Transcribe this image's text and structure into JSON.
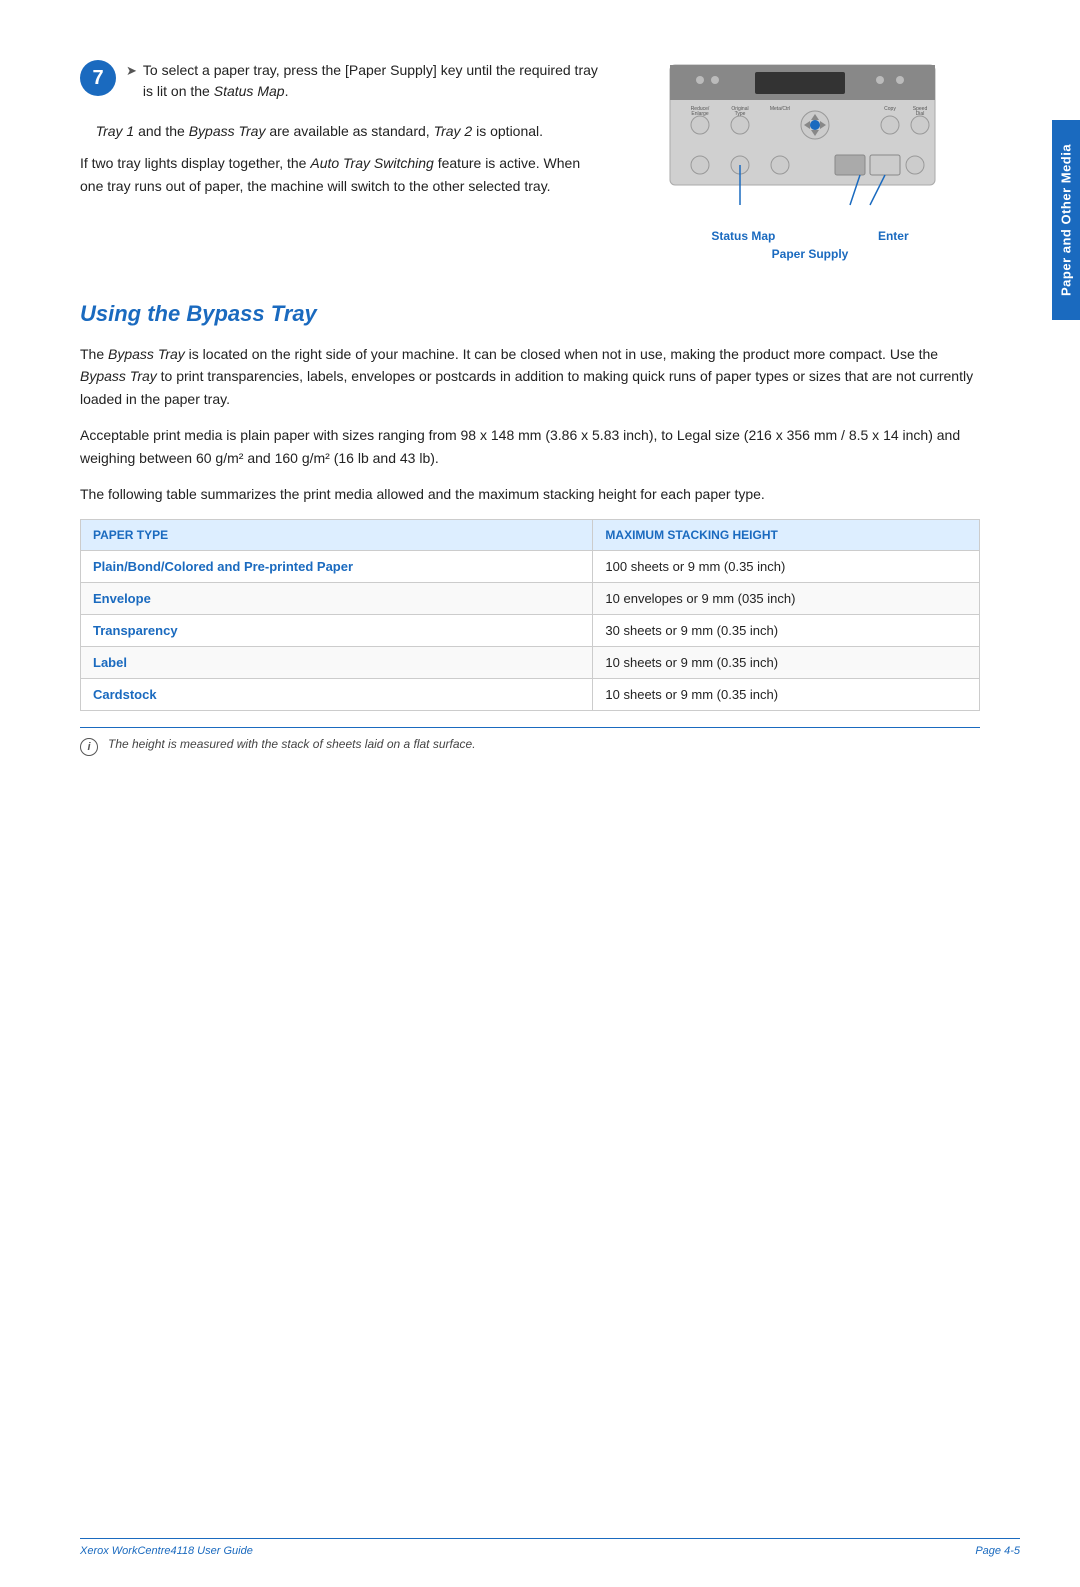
{
  "side_tab": {
    "label": "Paper and Other Media"
  },
  "step7": {
    "number": "7",
    "bullet1": "To select a paper tray, press the [Paper Supply] key until the required tray is lit on the",
    "bullet1_italic": "Status Map",
    "bullet2_part1": "Tray 1",
    "bullet2_part2": "and the",
    "bullet2_italic": "Bypass Tray",
    "bullet2_part3": "are available as standard,",
    "bullet2_italic2": "Tray 2",
    "bullet2_part4": "is optional.",
    "bullet3_part1": "If two tray lights display together, the",
    "bullet3_italic": "Auto Tray Switching",
    "bullet3_part2": "feature is active. When one tray runs out of paper, the machine will switch to the other selected tray.",
    "status_map_label": "Status Map",
    "enter_label": "Enter",
    "paper_supply_label": "Paper Supply"
  },
  "section": {
    "heading": "Using the Bypass Tray",
    "para1_part1": "The",
    "para1_italic": "Bypass Tray",
    "para1_part2": "is located on the right side of your machine. It can be closed when not in use, making the product more compact. Use the",
    "para1_italic2": "Bypass Tray",
    "para1_part3": "to print transparencies, labels, envelopes or postcards in addition to making quick runs of paper types or sizes that are not currently loaded in the paper tray.",
    "para2": "Acceptable print media is plain paper with sizes ranging from 98 x 148 mm (3.86 x 5.83 inch), to Legal size (216 x 356 mm / 8.5 x 14 inch) and weighing between 60 g/m² and 160 g/m² (16 lb and 43 lb).",
    "para3": "The following table summarizes the print media allowed and the maximum stacking height for each paper type."
  },
  "table": {
    "header_col1": "PAPER TYPE",
    "header_col2": "MAXIMUM STACKING HEIGHT",
    "rows": [
      {
        "paper_type": "Plain/Bond/Colored and Pre-printed Paper",
        "max_height": "100 sheets or 9 mm (0.35 inch)"
      },
      {
        "paper_type": "Envelope",
        "max_height": "10 envelopes or 9 mm (035 inch)"
      },
      {
        "paper_type": "Transparency",
        "max_height": "30 sheets or 9 mm (0.35 inch)"
      },
      {
        "paper_type": "Label",
        "max_height": "10 sheets or 9 mm (0.35 inch)"
      },
      {
        "paper_type": "Cardstock",
        "max_height": "10 sheets or 9 mm (0.35 inch)"
      }
    ]
  },
  "note": {
    "icon": "i",
    "text": "The height is measured with the stack of sheets laid on a flat surface."
  },
  "footer": {
    "left": "Xerox WorkCentre4118 User Guide",
    "right": "Page 4-5"
  }
}
